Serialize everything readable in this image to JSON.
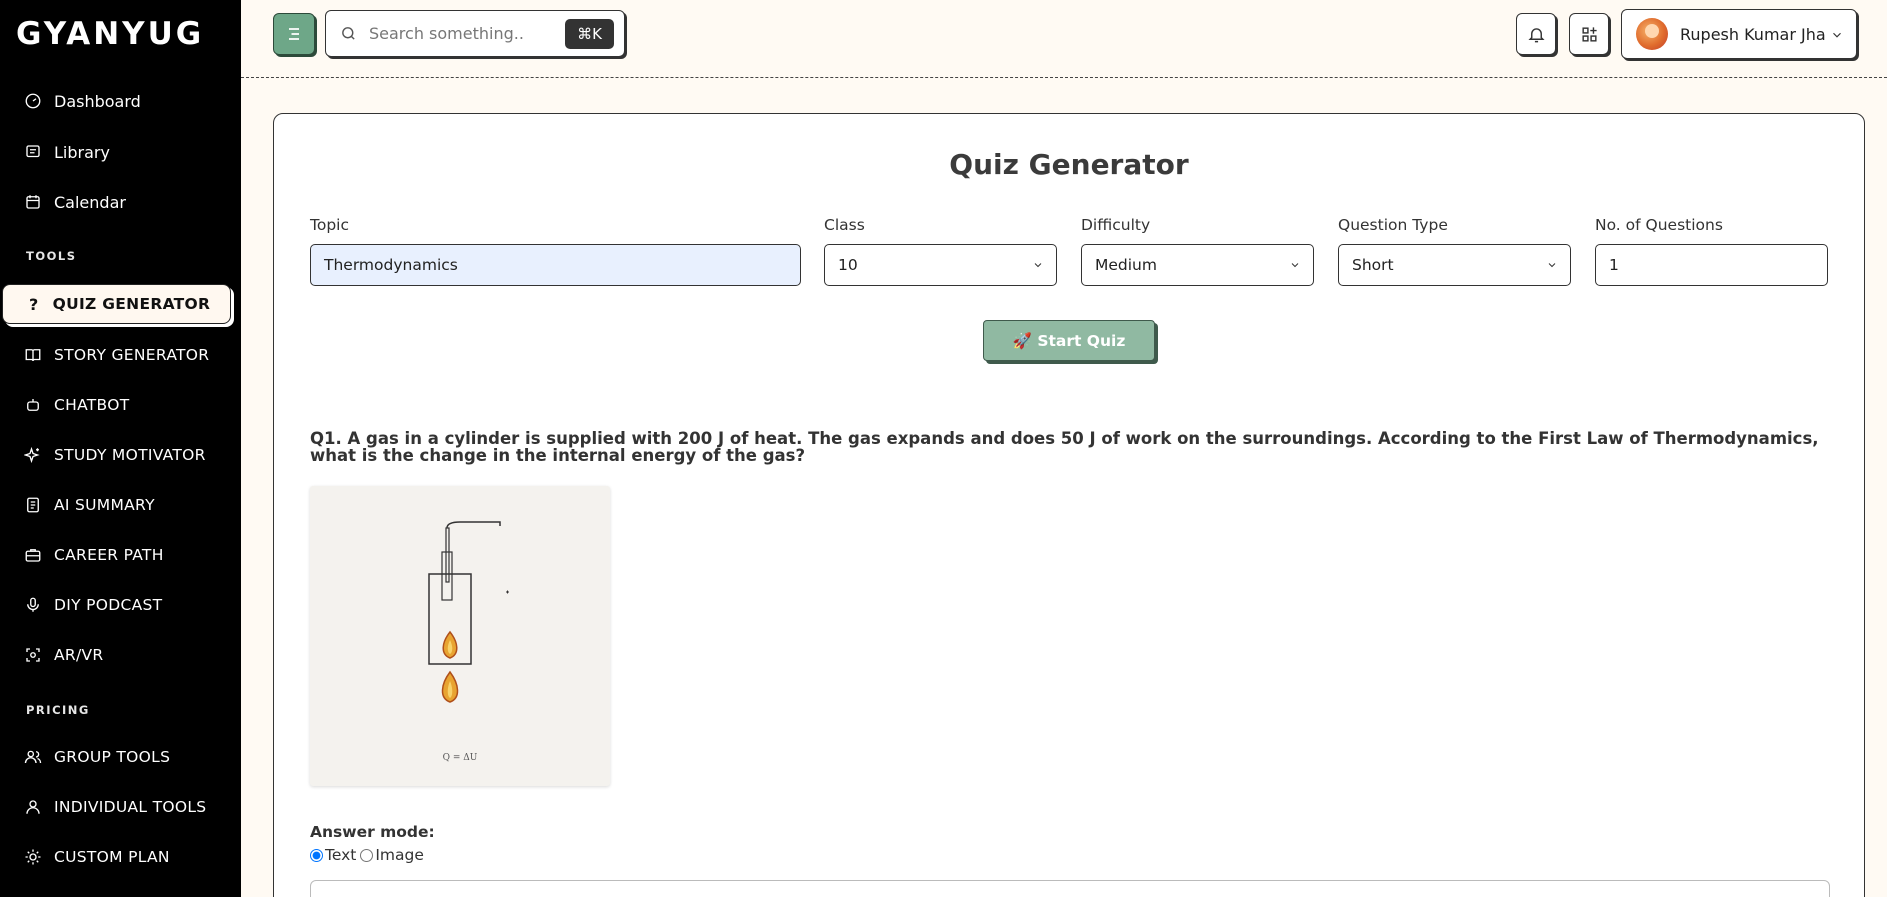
{
  "app": {
    "logo": "GYANYUG"
  },
  "sidebar": {
    "items": [
      {
        "label": "Dashboard",
        "icon": "dashboard-icon"
      },
      {
        "label": "Library",
        "icon": "library-icon"
      },
      {
        "label": "Calendar",
        "icon": "calendar-icon"
      }
    ],
    "tools_label": "TOOLS",
    "tools": [
      {
        "label": "QUIZ GENERATOR",
        "icon": "question-icon",
        "active": true
      },
      {
        "label": "STORY GENERATOR",
        "icon": "book-icon"
      },
      {
        "label": "CHATBOT",
        "icon": "bot-icon"
      },
      {
        "label": "STUDY MOTIVATOR",
        "icon": "sparkles-icon"
      },
      {
        "label": "AI SUMMARY",
        "icon": "document-icon"
      },
      {
        "label": "CAREER PATH",
        "icon": "briefcase-icon"
      },
      {
        "label": "DIY PODCAST",
        "icon": "microphone-icon"
      },
      {
        "label": "AR/VR",
        "icon": "ar-vr-icon"
      }
    ],
    "pricing_label": "PRICING",
    "pricing": [
      {
        "label": "GROUP TOOLS",
        "icon": "users-icon"
      },
      {
        "label": "INDIVIDUAL TOOLS",
        "icon": "user-icon"
      },
      {
        "label": "CUSTOM PLAN",
        "icon": "lightbulb-icon"
      }
    ]
  },
  "header": {
    "search_placeholder": "Search something..",
    "search_shortcut": "⌘K",
    "user_name": "Rupesh Kumar Jha"
  },
  "quiz": {
    "title": "Quiz Generator",
    "fields": {
      "topic_label": "Topic",
      "topic_value": "Thermodynamics",
      "class_label": "Class",
      "class_value": "10",
      "difficulty_label": "Difficulty",
      "difficulty_value": "Medium",
      "qtype_label": "Question Type",
      "qtype_value": "Short",
      "count_label": "No. of Questions",
      "count_value": "1"
    },
    "start_label": "🚀 Start Quiz",
    "question": "Q1. A gas in a cylinder is supplied with 200 J of heat. The gas expands and does 50 J of work on the surroundings. According to the First Law of Thermodynamics, what is the change in the internal energy of the gas?",
    "image_caption": "Q = ΔU",
    "answer_mode_label": "Answer mode:",
    "answer_modes": [
      "Text",
      "Image"
    ],
    "answer_mode_selected": "Text"
  },
  "colors": {
    "accent": "#6ea788",
    "sidebar_bg": "#000000",
    "page_bg": "#fffaf3",
    "topic_bg": "#e8f0fe"
  }
}
